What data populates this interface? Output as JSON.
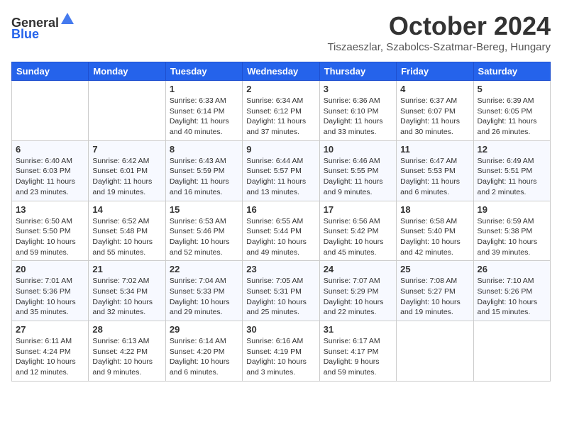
{
  "header": {
    "logo_general": "General",
    "logo_blue": "Blue",
    "month_title": "October 2024",
    "subtitle": "Tiszaeszlar, Szabolcs-Szatmar-Bereg, Hungary"
  },
  "weekdays": [
    "Sunday",
    "Monday",
    "Tuesday",
    "Wednesday",
    "Thursday",
    "Friday",
    "Saturday"
  ],
  "weeks": [
    [
      {
        "day": "",
        "info": ""
      },
      {
        "day": "",
        "info": ""
      },
      {
        "day": "1",
        "info": "Sunrise: 6:33 AM\nSunset: 6:14 PM\nDaylight: 11 hours and 40 minutes."
      },
      {
        "day": "2",
        "info": "Sunrise: 6:34 AM\nSunset: 6:12 PM\nDaylight: 11 hours and 37 minutes."
      },
      {
        "day": "3",
        "info": "Sunrise: 6:36 AM\nSunset: 6:10 PM\nDaylight: 11 hours and 33 minutes."
      },
      {
        "day": "4",
        "info": "Sunrise: 6:37 AM\nSunset: 6:07 PM\nDaylight: 11 hours and 30 minutes."
      },
      {
        "day": "5",
        "info": "Sunrise: 6:39 AM\nSunset: 6:05 PM\nDaylight: 11 hours and 26 minutes."
      }
    ],
    [
      {
        "day": "6",
        "info": "Sunrise: 6:40 AM\nSunset: 6:03 PM\nDaylight: 11 hours and 23 minutes."
      },
      {
        "day": "7",
        "info": "Sunrise: 6:42 AM\nSunset: 6:01 PM\nDaylight: 11 hours and 19 minutes."
      },
      {
        "day": "8",
        "info": "Sunrise: 6:43 AM\nSunset: 5:59 PM\nDaylight: 11 hours and 16 minutes."
      },
      {
        "day": "9",
        "info": "Sunrise: 6:44 AM\nSunset: 5:57 PM\nDaylight: 11 hours and 13 minutes."
      },
      {
        "day": "10",
        "info": "Sunrise: 6:46 AM\nSunset: 5:55 PM\nDaylight: 11 hours and 9 minutes."
      },
      {
        "day": "11",
        "info": "Sunrise: 6:47 AM\nSunset: 5:53 PM\nDaylight: 11 hours and 6 minutes."
      },
      {
        "day": "12",
        "info": "Sunrise: 6:49 AM\nSunset: 5:51 PM\nDaylight: 11 hours and 2 minutes."
      }
    ],
    [
      {
        "day": "13",
        "info": "Sunrise: 6:50 AM\nSunset: 5:50 PM\nDaylight: 10 hours and 59 minutes."
      },
      {
        "day": "14",
        "info": "Sunrise: 6:52 AM\nSunset: 5:48 PM\nDaylight: 10 hours and 55 minutes."
      },
      {
        "day": "15",
        "info": "Sunrise: 6:53 AM\nSunset: 5:46 PM\nDaylight: 10 hours and 52 minutes."
      },
      {
        "day": "16",
        "info": "Sunrise: 6:55 AM\nSunset: 5:44 PM\nDaylight: 10 hours and 49 minutes."
      },
      {
        "day": "17",
        "info": "Sunrise: 6:56 AM\nSunset: 5:42 PM\nDaylight: 10 hours and 45 minutes."
      },
      {
        "day": "18",
        "info": "Sunrise: 6:58 AM\nSunset: 5:40 PM\nDaylight: 10 hours and 42 minutes."
      },
      {
        "day": "19",
        "info": "Sunrise: 6:59 AM\nSunset: 5:38 PM\nDaylight: 10 hours and 39 minutes."
      }
    ],
    [
      {
        "day": "20",
        "info": "Sunrise: 7:01 AM\nSunset: 5:36 PM\nDaylight: 10 hours and 35 minutes."
      },
      {
        "day": "21",
        "info": "Sunrise: 7:02 AM\nSunset: 5:34 PM\nDaylight: 10 hours and 32 minutes."
      },
      {
        "day": "22",
        "info": "Sunrise: 7:04 AM\nSunset: 5:33 PM\nDaylight: 10 hours and 29 minutes."
      },
      {
        "day": "23",
        "info": "Sunrise: 7:05 AM\nSunset: 5:31 PM\nDaylight: 10 hours and 25 minutes."
      },
      {
        "day": "24",
        "info": "Sunrise: 7:07 AM\nSunset: 5:29 PM\nDaylight: 10 hours and 22 minutes."
      },
      {
        "day": "25",
        "info": "Sunrise: 7:08 AM\nSunset: 5:27 PM\nDaylight: 10 hours and 19 minutes."
      },
      {
        "day": "26",
        "info": "Sunrise: 7:10 AM\nSunset: 5:26 PM\nDaylight: 10 hours and 15 minutes."
      }
    ],
    [
      {
        "day": "27",
        "info": "Sunrise: 6:11 AM\nSunset: 4:24 PM\nDaylight: 10 hours and 12 minutes."
      },
      {
        "day": "28",
        "info": "Sunrise: 6:13 AM\nSunset: 4:22 PM\nDaylight: 10 hours and 9 minutes."
      },
      {
        "day": "29",
        "info": "Sunrise: 6:14 AM\nSunset: 4:20 PM\nDaylight: 10 hours and 6 minutes."
      },
      {
        "day": "30",
        "info": "Sunrise: 6:16 AM\nSunset: 4:19 PM\nDaylight: 10 hours and 3 minutes."
      },
      {
        "day": "31",
        "info": "Sunrise: 6:17 AM\nSunset: 4:17 PM\nDaylight: 9 hours and 59 minutes."
      },
      {
        "day": "",
        "info": ""
      },
      {
        "day": "",
        "info": ""
      }
    ]
  ]
}
